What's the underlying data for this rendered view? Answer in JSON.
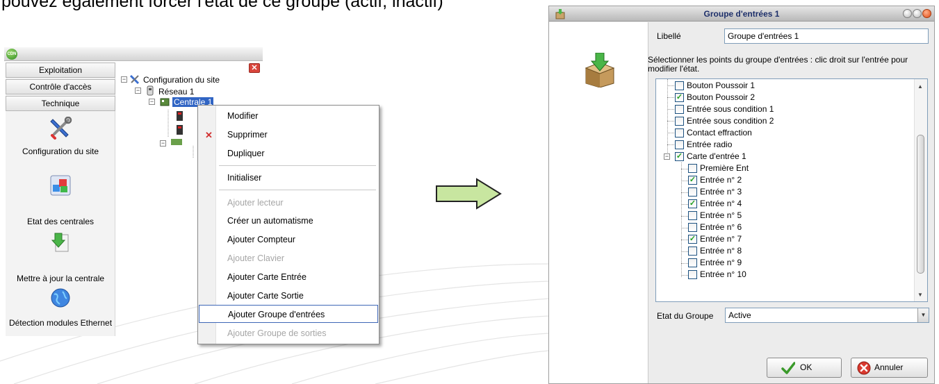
{
  "caption": "pouvez également forcer l'état de ce groupe (actif, inactif)",
  "left_window": {
    "sidebar_tabs": [
      "Exploitation",
      "Contrôle d'accès",
      "Technique"
    ],
    "sidebar_items": [
      {
        "label": "Configuration du site",
        "icon": "tools-icon"
      },
      {
        "label": "Etat des centrales",
        "icon": "status-blocks-icon"
      },
      {
        "label": "Mettre à jour la centrale",
        "icon": "update-download-icon"
      },
      {
        "label": "Détection modules Ethernet",
        "icon": "globe-network-icon"
      }
    ],
    "tree": {
      "root": "Configuration du site",
      "network": "Réseau 1",
      "selected_node": "Centrale 1"
    }
  },
  "context_menu": {
    "items": [
      {
        "label": "Modifier",
        "enabled": true
      },
      {
        "label": "Supprimer",
        "enabled": true,
        "icon": "delete-x-icon"
      },
      {
        "label": "Dupliquer",
        "enabled": true
      },
      {
        "label": "Initialiser",
        "enabled": true
      },
      {
        "label": "Ajouter lecteur",
        "enabled": false
      },
      {
        "label": "Créer un automatisme",
        "enabled": true
      },
      {
        "label": "Ajouter Compteur",
        "enabled": true
      },
      {
        "label": "Ajouter Clavier",
        "enabled": false
      },
      {
        "label": "Ajouter Carte Entrée",
        "enabled": true
      },
      {
        "label": "Ajouter Carte Sortie",
        "enabled": true
      },
      {
        "label": "Ajouter Groupe d'entrées",
        "enabled": true,
        "highlighted": true
      },
      {
        "label": "Ajouter Groupe de sorties",
        "enabled": false
      }
    ]
  },
  "dialog": {
    "title": "Groupe d'entrées 1",
    "libelle_label": "Libellé",
    "libelle_value": "Groupe d'entrées 1",
    "instructions": "Sélectionner les points du groupe d'entrées : clic droit sur l'entrée pour modifier l'état.",
    "points": [
      {
        "label": "Bouton Poussoir 1",
        "checked": false,
        "level": 0
      },
      {
        "label": "Bouton Poussoir 2",
        "checked": true,
        "level": 0
      },
      {
        "label": "Entrée sous condition 1",
        "checked": false,
        "level": 0
      },
      {
        "label": "Entrée sous condition 2",
        "checked": false,
        "level": 0
      },
      {
        "label": "Contact effraction",
        "checked": false,
        "level": 0
      },
      {
        "label": "Entrée radio",
        "checked": false,
        "level": 0
      },
      {
        "label": "Carte d'entrée 1",
        "checked": true,
        "level": 0,
        "expandable": true
      },
      {
        "label": "Première Ent",
        "checked": false,
        "level": 1
      },
      {
        "label": "Entrée n° 2",
        "checked": true,
        "level": 1
      },
      {
        "label": "Entrée n° 3",
        "checked": false,
        "level": 1
      },
      {
        "label": "Entrée n° 4",
        "checked": true,
        "level": 1
      },
      {
        "label": "Entrée n° 5",
        "checked": false,
        "level": 1
      },
      {
        "label": "Entrée n° 6",
        "checked": false,
        "level": 1
      },
      {
        "label": "Entrée n° 7",
        "checked": true,
        "level": 1
      },
      {
        "label": "Entrée n° 8",
        "checked": false,
        "level": 1
      },
      {
        "label": "Entrée n° 9",
        "checked": false,
        "level": 1
      },
      {
        "label": "Entrée n° 10",
        "checked": false,
        "level": 1
      }
    ],
    "etat_label": "Etat du Groupe",
    "etat_value": "Active",
    "ok_label": "OK",
    "cancel_label": "Annuler"
  },
  "colors": {
    "selection_blue": "#3165c4",
    "menu_highlight_border": "#3d66b6",
    "dialog_title_text": "#1d2f6a",
    "arrow_fill": "#c8e6a0",
    "disabled_text": "#a6a6a6"
  }
}
